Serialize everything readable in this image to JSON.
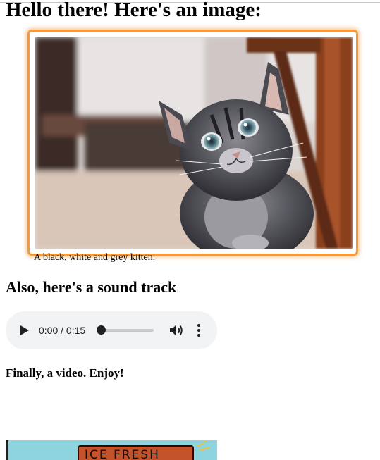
{
  "heading": "Hello there! Here's an image:",
  "image": {
    "alt": "A black, white and grey kitten.",
    "caption": "A black, white and grey kitten.",
    "frame_color": "#f59a3c"
  },
  "audio_section": {
    "heading": "Also, here's a sound track",
    "player": {
      "time": "0:00 / 0:15",
      "progress": 0,
      "play_icon": "play-icon",
      "volume_icon": "volume-icon",
      "menu_icon": "more-vert-icon"
    }
  },
  "video_section": {
    "heading": "Finally, a video. Enjoy!",
    "poster_text": "ICE FRESH"
  }
}
